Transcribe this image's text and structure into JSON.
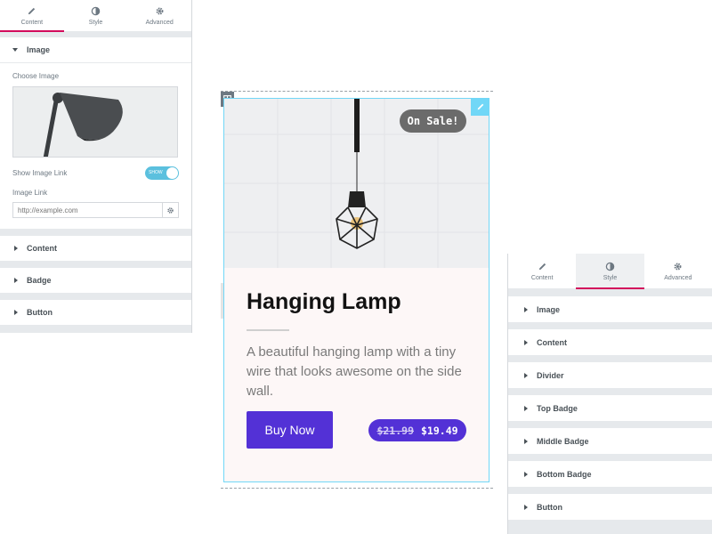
{
  "left_panel": {
    "tabs": [
      {
        "label": "Content",
        "icon": "pencil-icon",
        "active": true
      },
      {
        "label": "Style",
        "icon": "contrast-icon",
        "active": false
      },
      {
        "label": "Advanced",
        "icon": "gear-icon",
        "active": false
      }
    ],
    "image_section": {
      "title": "Image",
      "choose_image_label": "Choose Image",
      "show_link_label": "Show Image Link",
      "toggle_text": "SHOW",
      "toggle_on": true,
      "image_link_label": "Image Link",
      "url_placeholder": "http://example.com"
    },
    "collapsed_sections": [
      "Content",
      "Badge",
      "Button"
    ]
  },
  "card": {
    "badge": "On Sale!",
    "title": "Hanging Lamp",
    "description": "A beautiful hanging lamp with a tiny wire that looks awesome on the side wall.",
    "button_label": "Buy Now",
    "old_price": "$21.99",
    "new_price": "$19.49"
  },
  "right_panel": {
    "tabs": [
      {
        "label": "Content",
        "icon": "pencil-icon",
        "active": false
      },
      {
        "label": "Style",
        "icon": "contrast-icon",
        "active": true
      },
      {
        "label": "Advanced",
        "icon": "gear-icon",
        "active": false
      }
    ],
    "sections": [
      "Image",
      "Content",
      "Divider",
      "Top Badge",
      "Middle Badge",
      "Bottom Badge",
      "Button"
    ]
  },
  "colors": {
    "accent_pink": "#d30c5c",
    "button_purple": "#5331d6",
    "toggle_blue": "#5bc0de",
    "badge_grey": "#6b6b6b"
  }
}
